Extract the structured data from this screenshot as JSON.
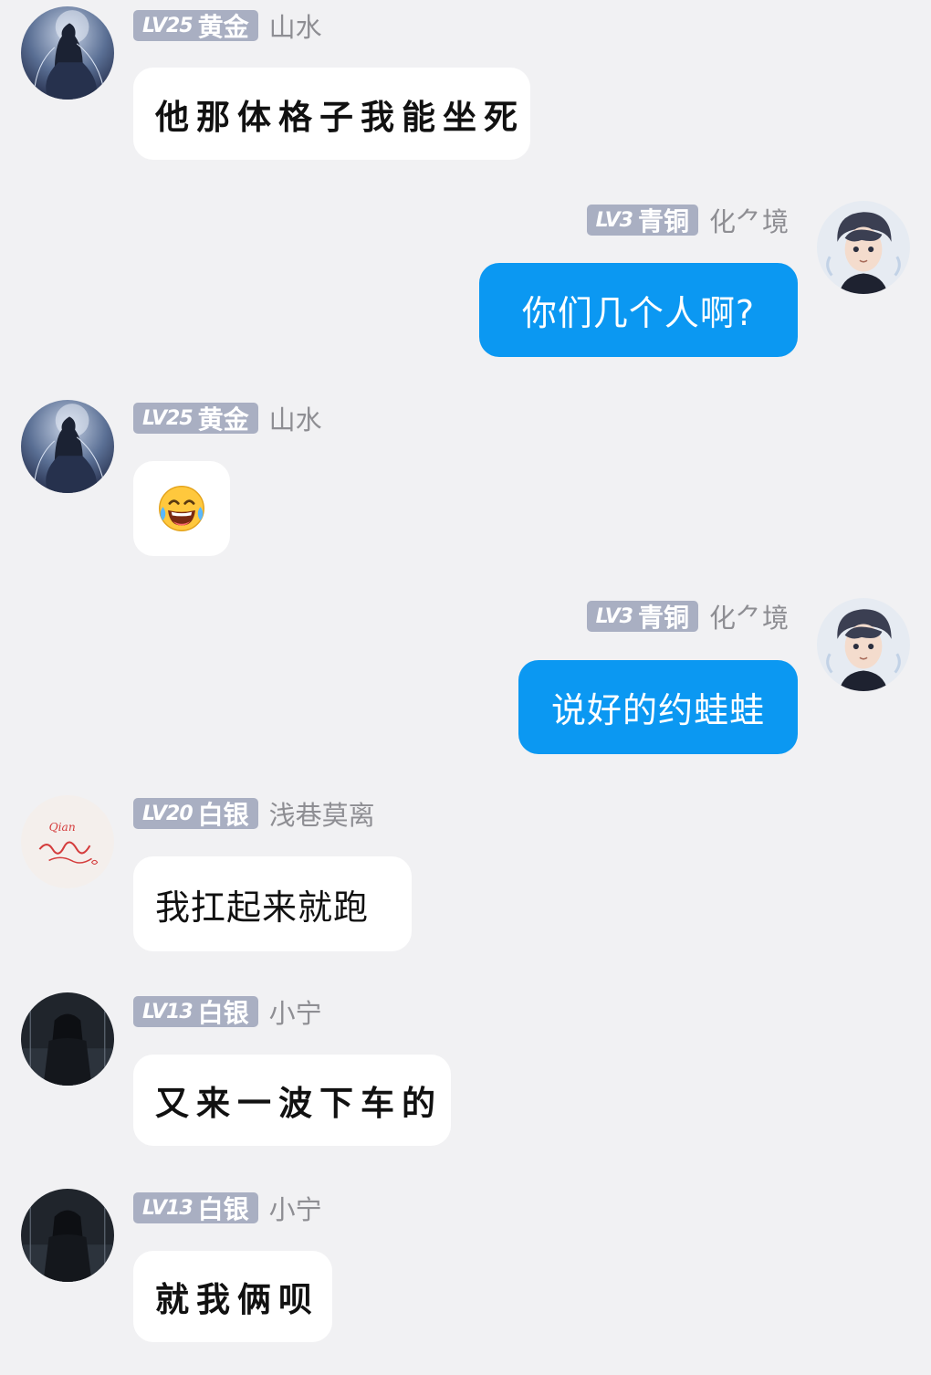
{
  "messages": [
    {
      "side": "left",
      "level": "LV25",
      "tier": "黄金",
      "name": "山水",
      "text": "他那体格子我能坐死",
      "avatar": "ink-robed-figure-avatar"
    },
    {
      "side": "right",
      "level": "LV3",
      "tier": "青铜",
      "name": "化⺈境",
      "text": "你们几个人啊?",
      "avatar": "anime-boy-avatar"
    },
    {
      "side": "left",
      "level": "LV25",
      "tier": "黄金",
      "name": "山水",
      "text": "",
      "emoji": "laughing-crying-emoji",
      "avatar": "ink-robed-figure-avatar"
    },
    {
      "side": "right",
      "level": "LV3",
      "tier": "青铜",
      "name": "化⺈境",
      "text": "说好的约蛙蛙",
      "avatar": "anime-boy-avatar"
    },
    {
      "side": "left",
      "level": "LV20",
      "tier": "白银",
      "name": "浅巷莫离",
      "text": "我扛起来就跑",
      "avatar": "signature-avatar",
      "avatar_text": "Qian"
    },
    {
      "side": "left",
      "level": "LV13",
      "tier": "白银",
      "name": "小宁",
      "text": "又来一波下车的",
      "avatar": "dark-hooded-figure-avatar"
    },
    {
      "side": "left",
      "level": "LV13",
      "tier": "白银",
      "name": "小宁",
      "text": "就我俩呗",
      "avatar": "dark-hooded-figure-avatar"
    }
  ],
  "colors": {
    "background": "#f1f1f3",
    "outgoing_bubble": "#0b98f2",
    "incoming_bubble": "#ffffff",
    "badge": "#a9afc2",
    "username": "#8e8e93"
  }
}
